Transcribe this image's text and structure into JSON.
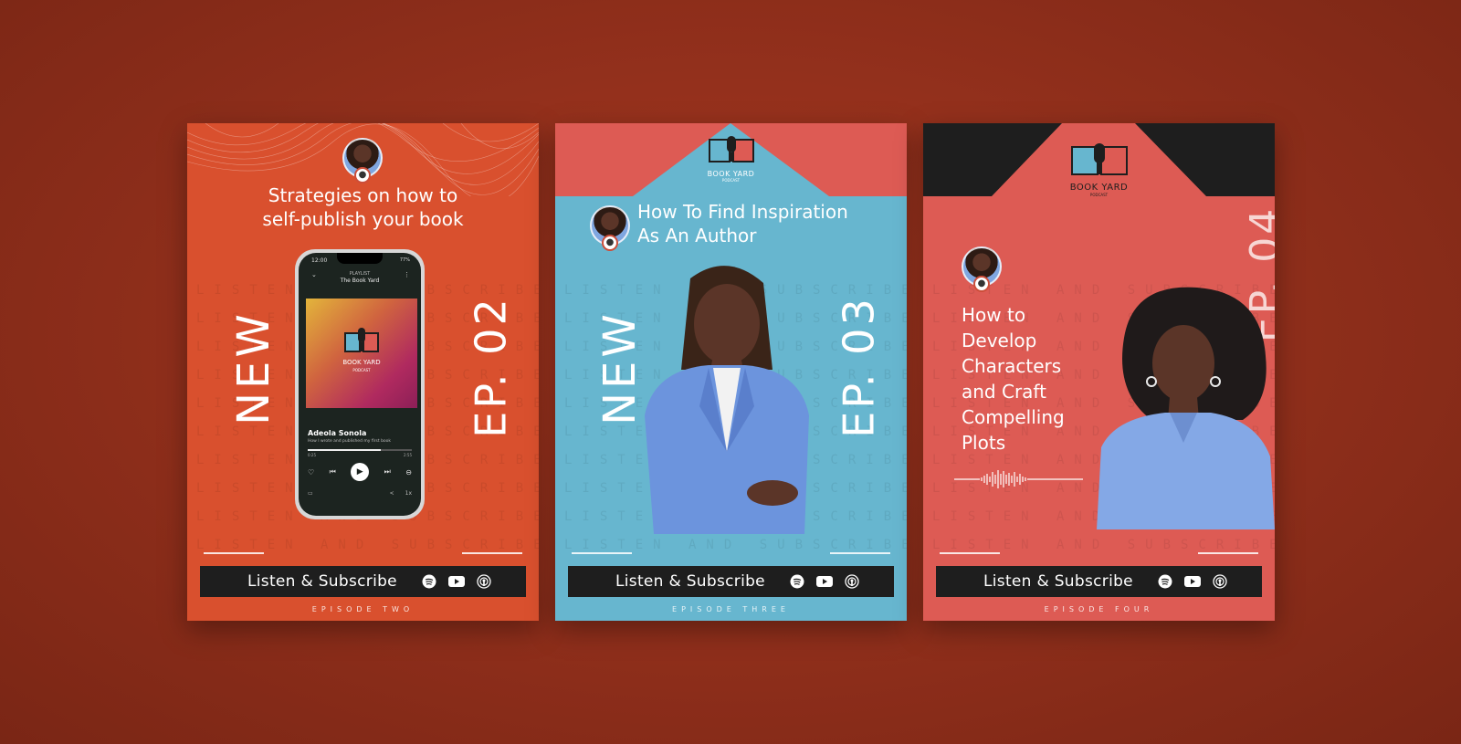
{
  "cards": [
    {
      "title_lines": [
        "Strategies on how to",
        "self-publish your book"
      ],
      "new_label": "NEW",
      "ep_label": "EP. 02",
      "watermark": "LISTEN AND SUBSCRIBE",
      "subscribe_label": "Listen & Subscribe",
      "episode_text": "EPISODE TWO",
      "bg_color": "#d9502e",
      "phone": {
        "time": "12:00",
        "battery": "77%",
        "playlist_label": "PLAYLIST",
        "playlist_name": "The Book Yard",
        "art_title": "BOOK YARD",
        "art_sub": "PODCAST",
        "artist": "Adeola Sonola",
        "track": "How I wrote and published my first book",
        "elapsed": "0:25",
        "total": "2:55",
        "progress": 0.7,
        "speed": "1x"
      }
    },
    {
      "logo_text": "BOOK YARD",
      "logo_sub": "PODCAST",
      "title_lines": [
        "How To Find Inspiration",
        "As An Author"
      ],
      "new_label": "NEW",
      "ep_label": "EP. 03",
      "watermark": "LISTEN AND SUBSCRIBE",
      "subscribe_label": "Listen & Subscribe",
      "episode_text": "EPISODE THREE",
      "bg_color": "#67b6cf",
      "header_color": "#dd5b54"
    },
    {
      "logo_text": "BOOK YARD",
      "logo_sub": "PODCAST",
      "title_lines": [
        "How to",
        "Develop",
        "Characters",
        "and Craft",
        "Compelling",
        "Plots"
      ],
      "ep_label": "EP. 04",
      "watermark": "LISTEN AND SUBSCRIBE",
      "subscribe_label": "Listen & Subscribe",
      "episode_text": "EPISODE FOUR",
      "bg_color": "#dd5b54",
      "header_color": "#1e1e1e"
    }
  ],
  "icons": [
    "spotify-icon",
    "youtube-icon",
    "podcast-icon"
  ]
}
